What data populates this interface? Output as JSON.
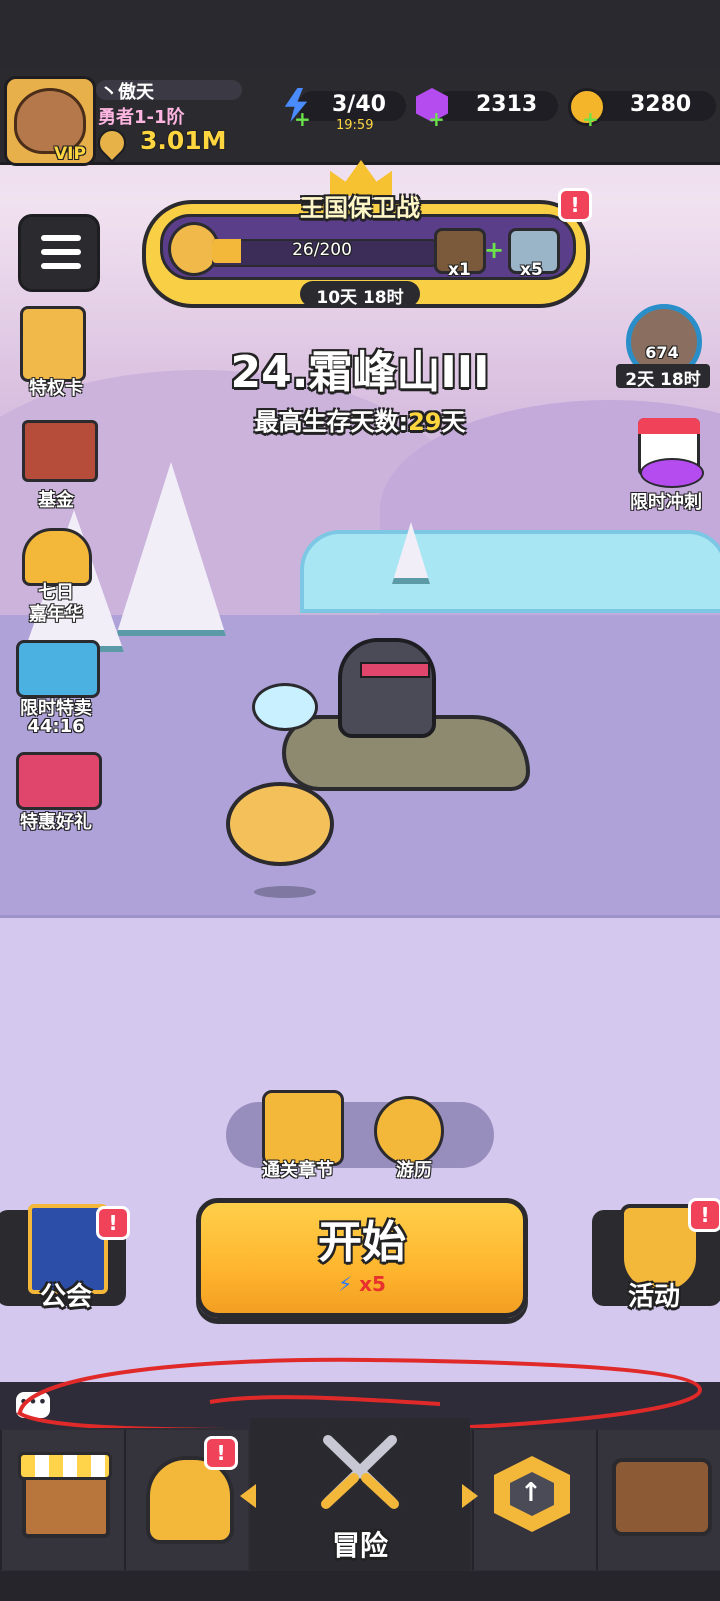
{
  "player": {
    "name": "丶傲天",
    "rank": "勇者1-1阶",
    "vip": "VIP",
    "power": "3.01M"
  },
  "resources": {
    "energy": "3/40",
    "energy_timer": "19:59",
    "gems": "2313",
    "coins": "3280"
  },
  "event_banner": {
    "title": "王国保卫战",
    "progress_text": "26/200",
    "progress_fraction": 0.13,
    "reward_1_count": "x1",
    "reward_2_count": "x5",
    "timer": "10天 18时",
    "alert": "!"
  },
  "left_features": [
    {
      "label": "特权卡",
      "icon": "privilege-card-icon"
    },
    {
      "label": "基金",
      "icon": "fund-icon"
    },
    {
      "label": "七日\n嘉年华",
      "icon": "carnival-icon"
    },
    {
      "label": "限时特卖",
      "sub": "44:16",
      "icon": "flash-sale-icon"
    },
    {
      "label": "特惠好礼",
      "icon": "gift-icon"
    }
  ],
  "stage": {
    "title": "24.霜峰山III",
    "best_prefix": "最高生存天数:",
    "best_days": "29",
    "best_suffix": "天"
  },
  "right_features": {
    "boss_count": "674",
    "boss_timer": "2天 18时",
    "sprint_label": "限时冲刺"
  },
  "chapter_actions": {
    "chapters": "通关章节",
    "travel": "游历"
  },
  "main_actions": {
    "start": "开始",
    "start_cost": "x5",
    "guild": "公会",
    "activity": "活动",
    "alert": "!"
  },
  "bottom_nav": {
    "center_label": "冒险",
    "items": [
      "shop",
      "equipment",
      "adventure",
      "upgrade",
      "treasure"
    ]
  },
  "colors": {
    "accent_gold": "#f3b73a",
    "alert_red": "#f0435a",
    "highlight_yellow": "#ffd640"
  }
}
